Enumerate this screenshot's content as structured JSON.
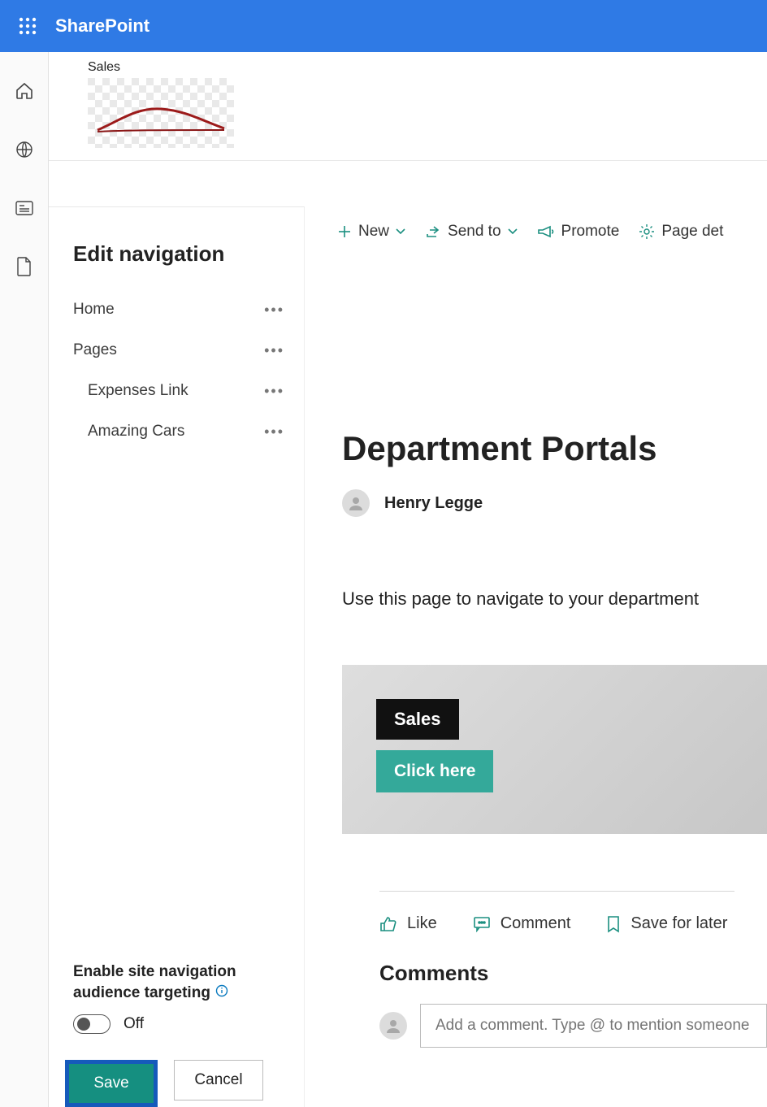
{
  "topbar": {
    "brand": "SharePoint"
  },
  "site": {
    "name": "Sales"
  },
  "nav": {
    "heading": "Edit navigation",
    "items": [
      {
        "label": "Home",
        "level": 0
      },
      {
        "label": "Pages",
        "level": 0
      },
      {
        "label": "Expenses Link",
        "level": 1
      },
      {
        "label": "Amazing Cars",
        "level": 1
      }
    ],
    "audience": {
      "title1": "Enable site navigation",
      "title2": "audience targeting",
      "state": "Off"
    },
    "save": "Save",
    "cancel": "Cancel"
  },
  "cmd": {
    "new": "New",
    "sendto": "Send to",
    "promote": "Promote",
    "pagedet": "Page det"
  },
  "page": {
    "title": "Department Portals",
    "author": "Henry Legge",
    "desc": "Use this page to navigate to your department",
    "hero_label": "Sales",
    "hero_button": "Click here"
  },
  "social": {
    "like": "Like",
    "comment": "Comment",
    "save": "Save for later"
  },
  "comments": {
    "heading": "Comments",
    "placeholder": "Add a comment. Type @ to mention someone"
  }
}
